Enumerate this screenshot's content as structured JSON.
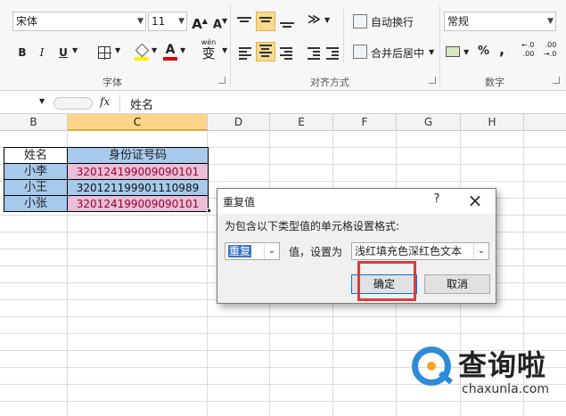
{
  "ribbon": {
    "font_name": "宋体",
    "font_size": "11",
    "grow_font": "A",
    "shrink_font": "A",
    "bold": "B",
    "italic": "I",
    "underline": "U",
    "font_color_letter": "A",
    "wen": "wén",
    "wen_char": "变",
    "groups": {
      "font": "字体",
      "alignment": "对齐方式",
      "number": "数字"
    },
    "wrap_text": "自动换行",
    "merge_center": "合并后居中",
    "number_format": "常规",
    "percent": "%",
    "comma": ",",
    "inc_decimal_top": "←.0",
    "inc_decimal_bottom": ".00",
    "dec_decimal_top": ".00",
    "dec_decimal_bottom": "→.0"
  },
  "formula_bar": {
    "fx": "fx",
    "content": "姓名"
  },
  "columns": [
    "B",
    "C",
    "D",
    "E",
    "F",
    "G",
    "H"
  ],
  "table": {
    "header": [
      "姓名",
      "身份证号码"
    ],
    "rows": [
      [
        "小李",
        "320124199009090101"
      ],
      [
        "小王",
        "320121199901110989"
      ],
      [
        "小张",
        "320124199009090101"
      ]
    ],
    "colors": {
      "header_bg": "#a6c9ec",
      "dup_bg": "#ffc7ce",
      "dup_text": "#9c0006",
      "name_bg": "#a6c9ec"
    }
  },
  "dialog": {
    "title": "重复值",
    "help": "?",
    "close": "×",
    "prompt": "为包含以下类型值的单元格设置格式:",
    "type_value": "重复",
    "mid_label": "值，设置为",
    "format_value": "浅红填充色深红色文本",
    "ok": "确定",
    "cancel": "取消"
  },
  "watermark": {
    "brand": "查询啦",
    "domain": "chaxunla.com"
  }
}
